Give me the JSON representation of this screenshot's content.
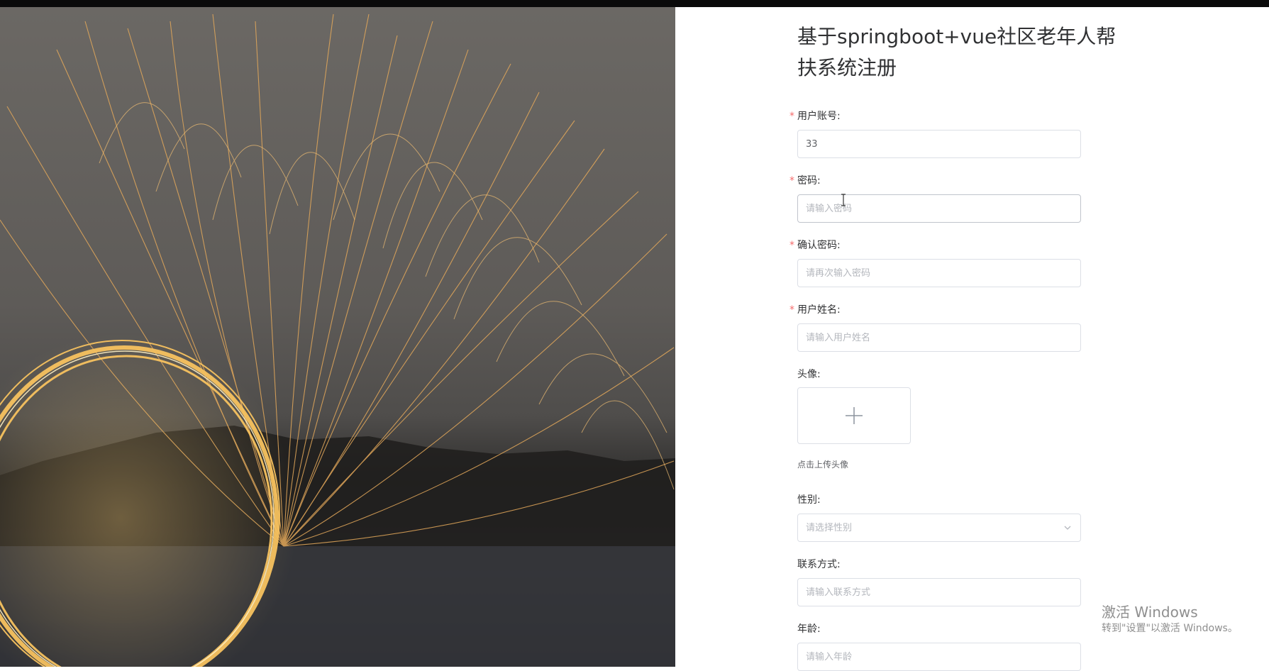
{
  "page": {
    "title": "基于springboot+vue社区老年人帮扶系统注册"
  },
  "form": {
    "account": {
      "label": "用户账号:",
      "required_mark": "*",
      "value": "33",
      "placeholder": ""
    },
    "password": {
      "label": "密码:",
      "required_mark": "*",
      "value": "",
      "placeholder": "请输入密码"
    },
    "confirm_password": {
      "label": "确认密码:",
      "required_mark": "*",
      "value": "",
      "placeholder": "请再次输入密码"
    },
    "user_name": {
      "label": "用户姓名:",
      "required_mark": "*",
      "value": "",
      "placeholder": "请输入用户姓名"
    },
    "avatar": {
      "label": "头像:",
      "tip": "点击上传头像",
      "icon": "plus-icon"
    },
    "gender": {
      "label": "性别:",
      "placeholder": "请选择性别",
      "icon": "chevron-down-icon"
    },
    "contact": {
      "label": "联系方式:",
      "value": "",
      "placeholder": "请输入联系方式"
    },
    "age": {
      "label": "年龄:",
      "value": "",
      "placeholder": "请输入年龄"
    }
  },
  "watermark": {
    "line1": "激活 Windows",
    "line2": "转到\"设置\"以激活 Windows。"
  },
  "colors": {
    "required": "#f56c6c",
    "border": "#dcdfe6",
    "text": "#303133",
    "placeholder": "#b4b7bd"
  }
}
